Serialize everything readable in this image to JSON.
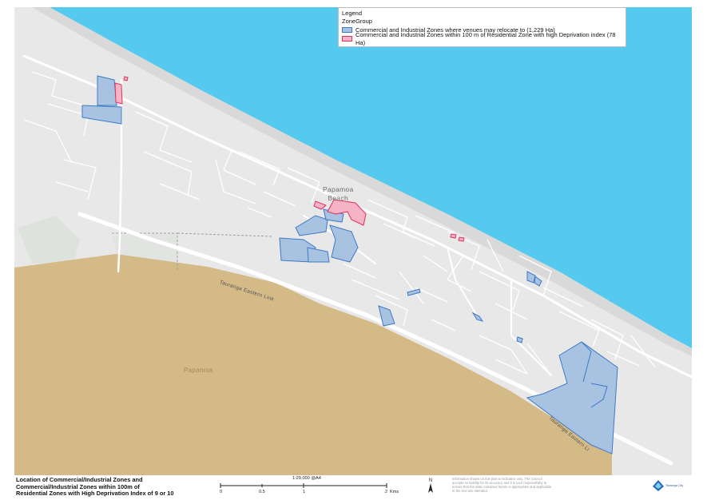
{
  "legend": {
    "title": "Legend",
    "group": "ZoneGroup",
    "items": [
      {
        "label": "Commercial and Industrial Zones where venues may relocate to (1,229 Ha)",
        "color": "#a7c3e1",
        "stroke": "#3f78c6"
      },
      {
        "label": "Commercial and Industrial Zones within 100 m of Residential Zone with high Deprivation index (78 Ha)",
        "color": "#f4b3c6",
        "stroke": "#e0315f"
      }
    ]
  },
  "map_labels": {
    "papamoa_beach_1": "Papamoa",
    "papamoa_beach_2": "Beach",
    "papamoa": "Papamoa",
    "road_1": "Tauranga Eastern Link",
    "road_2": "Tauranga Eastern Li"
  },
  "colors": {
    "sea": "#55c9ee",
    "beach": "#dcdcdc",
    "land": "#e8e8e8",
    "rural": "#d4ba87",
    "zone_blue": "#a7c3e1",
    "zone_pink": "#f4b3c6"
  },
  "title": {
    "line1": "Location of Commercial/Industrial Zones and",
    "line2": "Commercial/Industrial Zones within 100m of",
    "line3": "Residential Zones with High Deprivation Index of 9 or 10"
  },
  "scale": {
    "ratio": "1:29,000  @A4",
    "ticks": [
      "0",
      "0.5",
      "1",
      "2"
    ],
    "unit": "Kms"
  },
  "north_label": "N",
  "disclaimer": "Information shown on this plan is indicative only. The Council accepts no liability for its accuracy and it is your responsibility to ensure that the data contained herein is appropriate and applicable to the end use intended.",
  "logo_text": "Tauranga City"
}
